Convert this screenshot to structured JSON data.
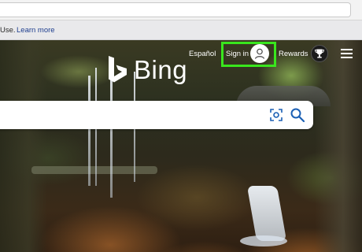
{
  "notice": {
    "text": "Use.",
    "link": "Learn more"
  },
  "header": {
    "logo_text": "Bing",
    "language_link": "Español",
    "signin_label": "Sign in",
    "rewards_label": "Rewards",
    "highlight_color": "#39e61d"
  },
  "icons": {
    "avatar": "user-avatar-icon",
    "trophy": "trophy-icon",
    "menu": "hamburger-menu-icon",
    "visual_search": "visual-search-icon",
    "search": "search-icon"
  },
  "search": {
    "value": "",
    "placeholder": ""
  }
}
